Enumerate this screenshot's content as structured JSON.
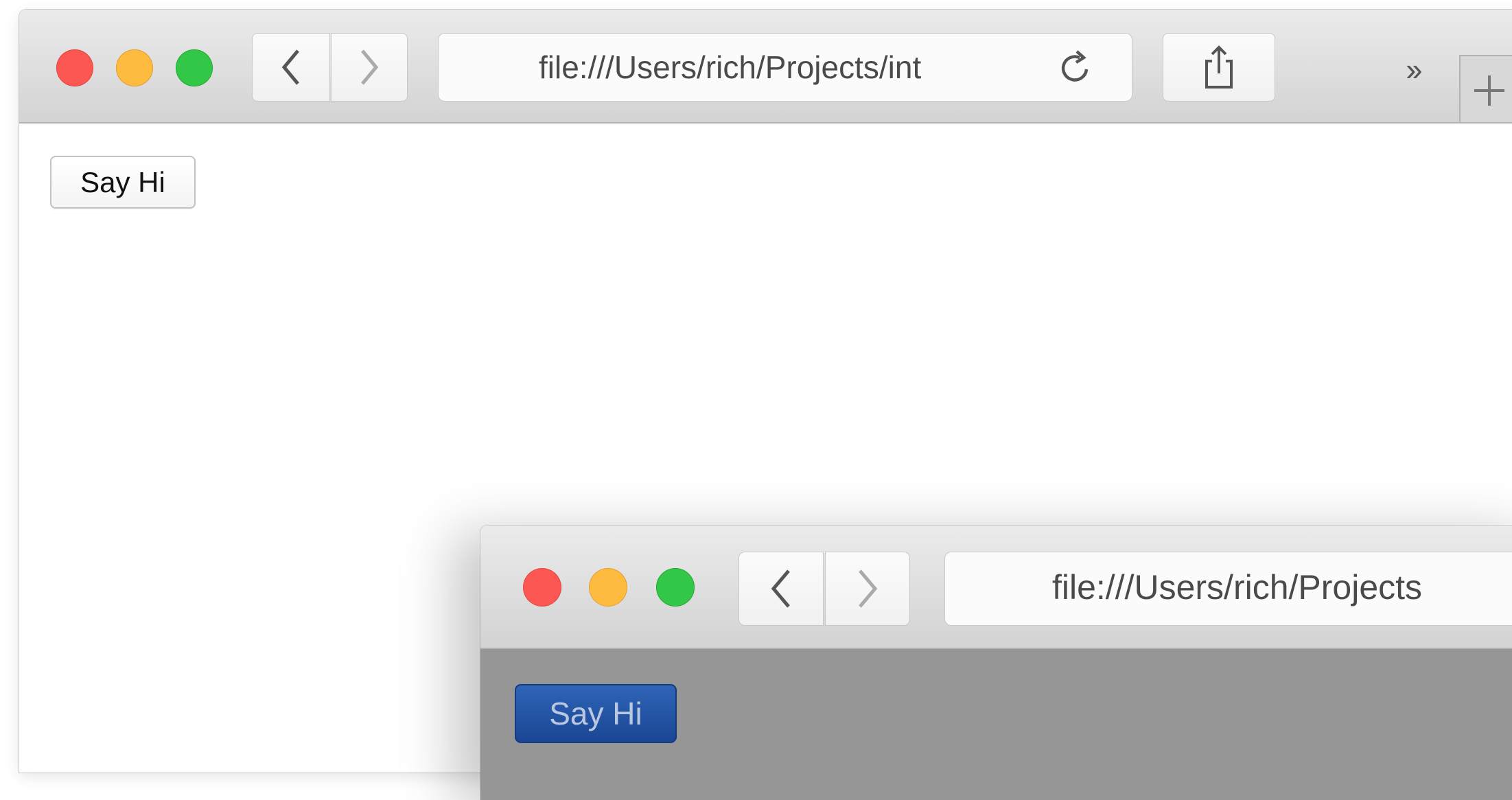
{
  "browser_back": {
    "url": "file:///Users/rich/Projects/int",
    "overflow_label": "››",
    "new_tab_label": "+",
    "content": {
      "button_label": "Say Hi"
    }
  },
  "browser_front": {
    "url": "file:///Users/rich/Projects",
    "content": {
      "button_label": "Say Hi"
    }
  },
  "colors": {
    "close": "#fc5753",
    "minimize": "#fdbc40",
    "zoom": "#33c748",
    "front_content_bg": "#969696",
    "front_button_bg": "#1f4d9c"
  },
  "icons": [
    "back-chevron-icon",
    "forward-chevron-icon",
    "reload-icon",
    "share-icon",
    "chevron-overflow-icon",
    "plus-icon"
  ]
}
